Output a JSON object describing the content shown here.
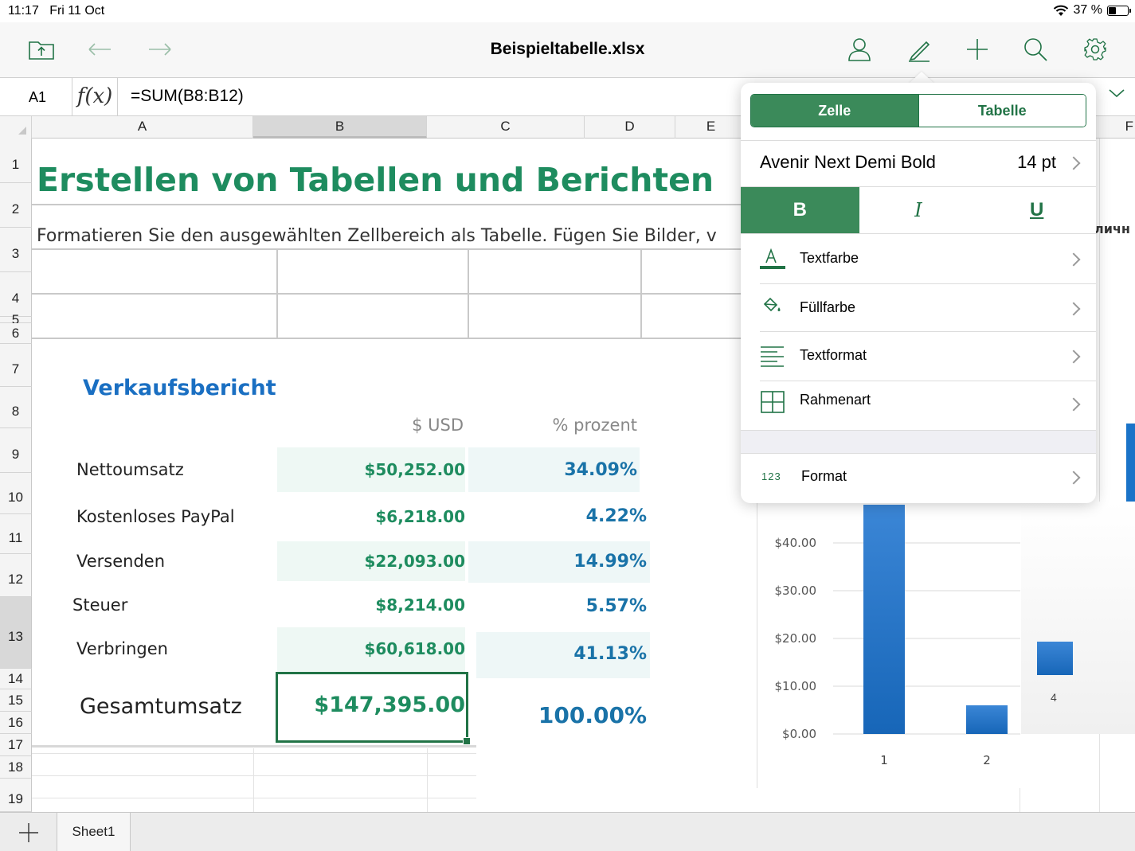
{
  "status": {
    "time": "11:17",
    "date": "Fri 11 Oct",
    "battery": "37 %",
    "battery_level": 0.37
  },
  "toolbar": {
    "title": "Beispieltabelle.xlsx"
  },
  "formula_bar": {
    "cell_ref": "A1",
    "fx_label": "f(x)",
    "formula": "=SUM(B8:B12)"
  },
  "columns": [
    "A",
    "B",
    "C",
    "D",
    "E"
  ],
  "rows": [
    "1",
    "2",
    "3",
    "4",
    "5",
    "6",
    "7",
    "8",
    "9",
    "10",
    "11",
    "12",
    "13",
    "14",
    "15",
    "16",
    "17",
    "18",
    "19"
  ],
  "sheet": {
    "title": "Erstellen von Tabellen und Berichten",
    "subtitle": "Formatieren Sie den ausgewählten Zellbereich als Tabelle. Fügen Sie Bilder, v",
    "report_title": "Verkaufsbericht",
    "col_usd": "$ USD",
    "col_pct": "% prozent",
    "items": [
      {
        "label": "Nettoumsatz",
        "usd": "$50,252.00",
        "pct": "34.09%"
      },
      {
        "label": "Kostenloses PayPal",
        "usd": "$6,218.00",
        "pct": "4.22%"
      },
      {
        "label": "Versenden",
        "usd": "$22,093.00",
        "pct": "14.99%"
      },
      {
        "label": "Steuer",
        "usd": "$8,214.00",
        "pct": "5.57%"
      },
      {
        "label": "Verbringen",
        "usd": "$60,618.00",
        "pct": "41.13%"
      }
    ],
    "total_label": "Gesamtumsatz",
    "total_usd": "$147,395.00",
    "total_pct": "100.00%",
    "right_edge_text": "личн"
  },
  "chart_data": {
    "type": "bar",
    "categories": [
      "1",
      "2"
    ],
    "values": [
      48,
      6
    ],
    "ytick_labels": [
      "$40.00",
      "$30.00",
      "$20.00",
      "$10.00",
      "$0.00"
    ],
    "yticks": [
      40,
      30,
      20,
      10,
      0
    ],
    "ylim": [
      0,
      50
    ],
    "partial_category": "4",
    "color": "#1a73c8"
  },
  "popover": {
    "tabs": [
      "Zelle",
      "Tabelle"
    ],
    "font_name": "Avenir Next Demi Bold",
    "font_size": "14 pt",
    "bold": "B",
    "italic": "I",
    "underline": "U",
    "menu": [
      {
        "label": "Textfarbe",
        "icon": "text-color-icon"
      },
      {
        "label": "Füllfarbe",
        "icon": "fill-color-icon"
      },
      {
        "label": "Textformat",
        "icon": "text-format-icon"
      },
      {
        "label": "Rahmenart",
        "icon": "border-style-icon"
      }
    ],
    "format_icon_text": "123",
    "format_label": "Format"
  },
  "sheet_tabs": [
    "Sheet1"
  ],
  "colors": {
    "accent": "#217346",
    "green_text": "#1e8c5f",
    "blue_text": "#1a6fc2"
  }
}
